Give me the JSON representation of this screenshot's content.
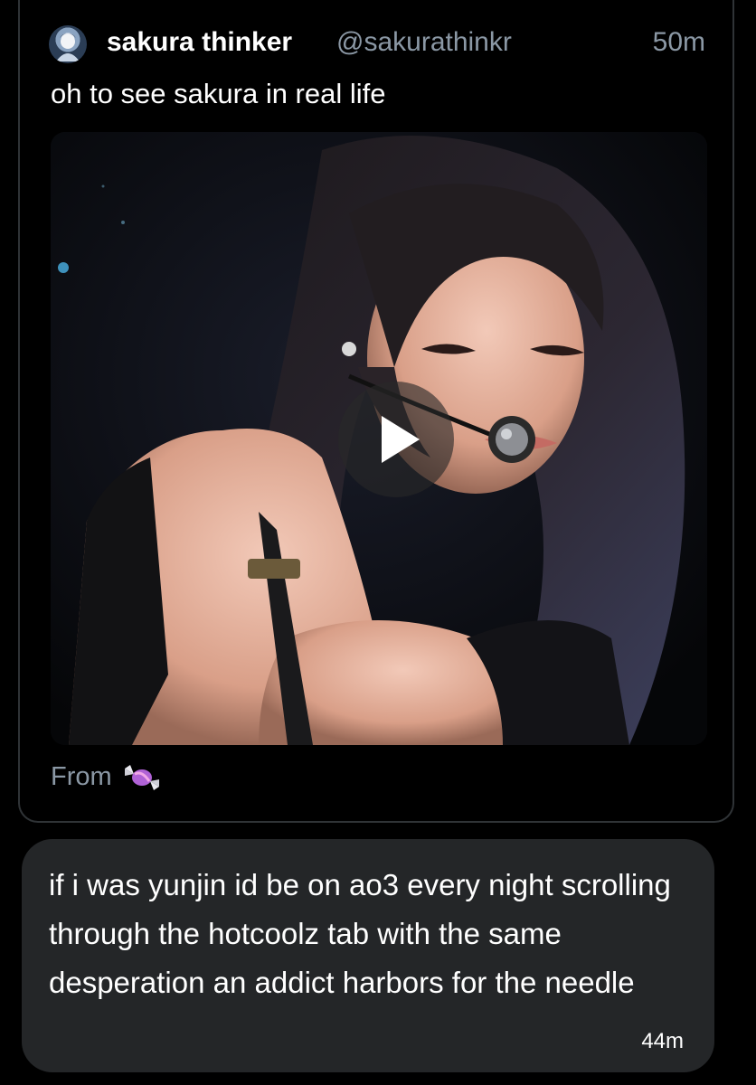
{
  "quoted_post": {
    "author_name": "sakura thinker",
    "author_handle": "@sakurathinkr",
    "time": "50m",
    "text": "oh to see sakura in real life",
    "source_label": "From",
    "source_icon": "candy-icon",
    "media_icon": "play-icon"
  },
  "reply": {
    "text": "if i was yunjin id be on ao3 every night scrolling through the hotcoolz tab with the same desperation an addict harbors for the needle",
    "time": "44m"
  }
}
